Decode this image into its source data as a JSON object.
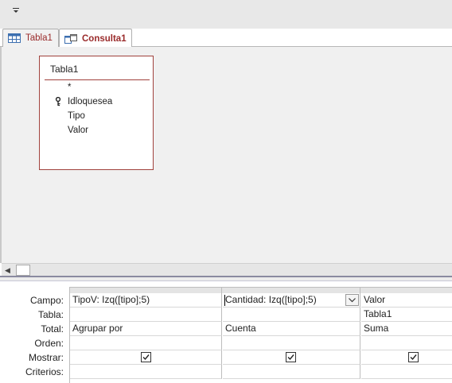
{
  "qat": {
    "customize_icon": "chevron-down-icon",
    "glyph": "⏷"
  },
  "tabs": [
    {
      "label": "Tabla1",
      "icon": "table-icon"
    },
    {
      "label": "Consulta1",
      "icon": "query-icon"
    }
  ],
  "table_box": {
    "title": "Tabla1",
    "fields": [
      "*",
      "Idloquesea",
      "Tipo",
      "Valor"
    ],
    "primary_key_field": "Idloquesea"
  },
  "scrollbar": {
    "left_arrow": "◀"
  },
  "grid": {
    "row_labels": [
      "Campo:",
      "Tabla:",
      "Total:",
      "Orden:",
      "Mostrar:",
      "Criterios:"
    ],
    "columns": [
      {
        "campo": "TipoV: Izq([tipo];5)",
        "tabla": "",
        "total": "Agrupar por",
        "orden": "",
        "mostrar": true,
        "criterios": ""
      },
      {
        "campo": "Cantidad: Izq([tipo];5)",
        "tabla": "",
        "total": "Cuenta",
        "orden": "",
        "mostrar": true,
        "criterios": ""
      },
      {
        "campo": "Valor",
        "tabla": "Tabla1",
        "total": "Suma",
        "orden": "",
        "mostrar": true,
        "criterios": ""
      }
    ]
  },
  "colors": {
    "accent": "#a0413c",
    "tab_text": "#9a2b2b",
    "splitter": "#8a8aa0"
  }
}
